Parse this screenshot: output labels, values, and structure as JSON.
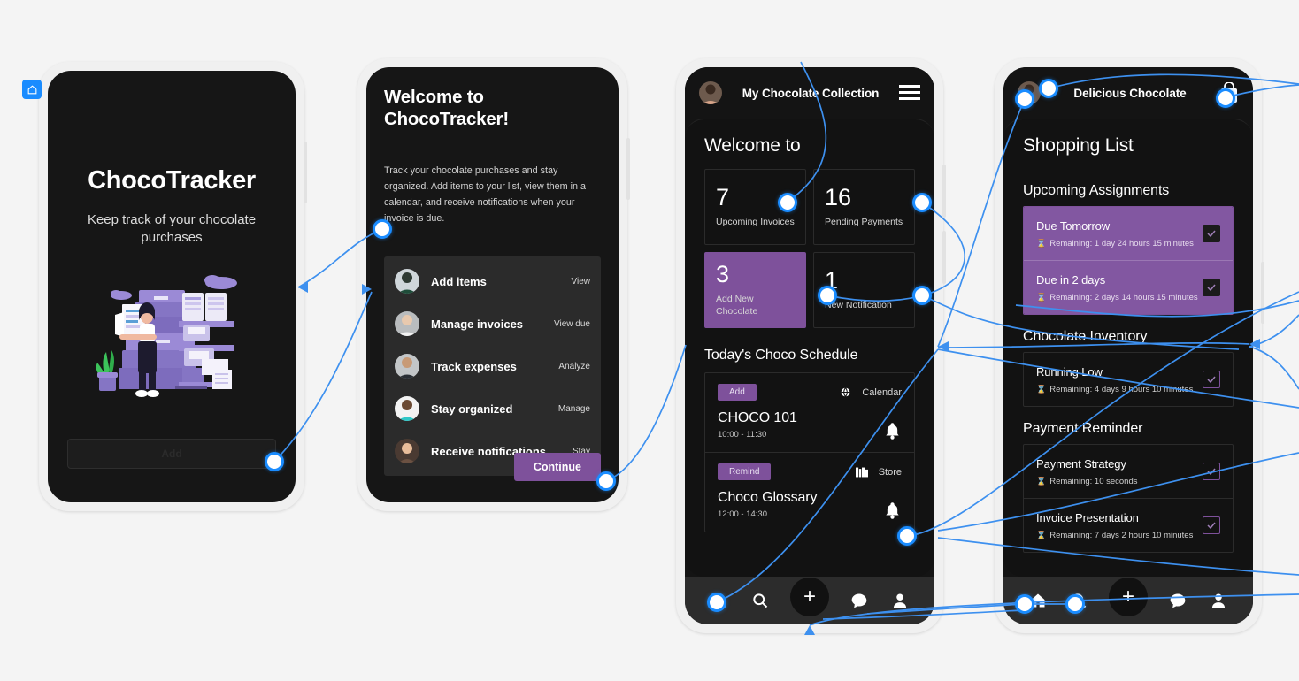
{
  "canvas": {
    "background": "#f4f4f4",
    "connector_color": "#1a8cff",
    "accent_purple": "#7e519b"
  },
  "overlay": {
    "home_badge_icon": "home-icon"
  },
  "screen1": {
    "title": "ChocoTracker",
    "subtitle": "Keep track of your chocolate purchases",
    "illustration": "documents-stack-illustration",
    "add_button": "Add"
  },
  "screen2": {
    "title": "Welcome to ChocoTracker!",
    "body": "Track your chocolate purchases and stay organized. Add items to your list, view them in a calendar, and receive notifications when your invoice is due.",
    "items": [
      {
        "label": "Add items",
        "action": "View"
      },
      {
        "label": "Manage invoices",
        "action": "View due"
      },
      {
        "label": "Track expenses",
        "action": "Analyze"
      },
      {
        "label": "Stay organized",
        "action": "Manage"
      },
      {
        "label": "Receive notifications",
        "action": "Stay"
      }
    ],
    "continue_button": "Continue"
  },
  "screen3": {
    "appbar": {
      "title": "My Chocolate Collection",
      "avatar": "user-avatar",
      "menu_icon": "hamburger-menu-icon"
    },
    "sheet_heading": "Welcome to",
    "stats": [
      {
        "number": "7",
        "caption": "Upcoming Invoices",
        "highlighted": false
      },
      {
        "number": "16",
        "caption": "Pending Payments",
        "highlighted": false
      },
      {
        "number": "3",
        "caption": "Add New Chocolate",
        "highlighted": true
      },
      {
        "number": "1",
        "caption": "New Notification",
        "highlighted": false
      }
    ],
    "schedule_heading": "Today's Choco Schedule",
    "events": [
      {
        "chip": "Add",
        "meta_icon": "globe-icon",
        "meta": "Calendar",
        "title": "CHOCO 101",
        "time": "10:00 - 11:30",
        "bell": "bell-icon"
      },
      {
        "chip": "Remind",
        "meta_icon": "book-icon",
        "meta": "Store",
        "title": "Choco Glossary",
        "time": "12:00 - 14:30",
        "bell": "bell-icon"
      }
    ],
    "tabs": [
      "home-icon",
      "search-icon",
      "add-icon",
      "chat-icon",
      "profile-icon"
    ]
  },
  "screen4": {
    "appbar": {
      "title": "Delicious Chocolate",
      "avatar": "user-avatar",
      "bag_icon": "shopping-bag-icon"
    },
    "sheet_heading": "Shopping List",
    "sections": [
      {
        "heading": "Upcoming Assignments",
        "highlighted": true,
        "tasks": [
          {
            "name": "Due Tomorrow",
            "remaining": "Remaining: 1 day 24 hours 15 minutes",
            "checked": true
          },
          {
            "name": "Due in 2 days",
            "remaining": "Remaining: 2 days 14 hours 15 minutes",
            "checked": true
          }
        ]
      },
      {
        "heading": "Chocolate Inventory",
        "highlighted": false,
        "tasks": [
          {
            "name": "Running Low",
            "remaining": "Remaining: 4 days 9 hours 10 minutes",
            "checked": true
          }
        ]
      },
      {
        "heading": "Payment Reminder",
        "highlighted": false,
        "tasks": [
          {
            "name": "Payment Strategy",
            "remaining": "Remaining: 10 seconds",
            "checked": true
          },
          {
            "name": "Invoice Presentation",
            "remaining": "Remaining: 7 days 2 hours 10 minutes",
            "checked": true
          }
        ]
      }
    ],
    "tabs": [
      "home-icon",
      "search-icon",
      "add-icon",
      "chat-icon",
      "profile-icon"
    ]
  }
}
